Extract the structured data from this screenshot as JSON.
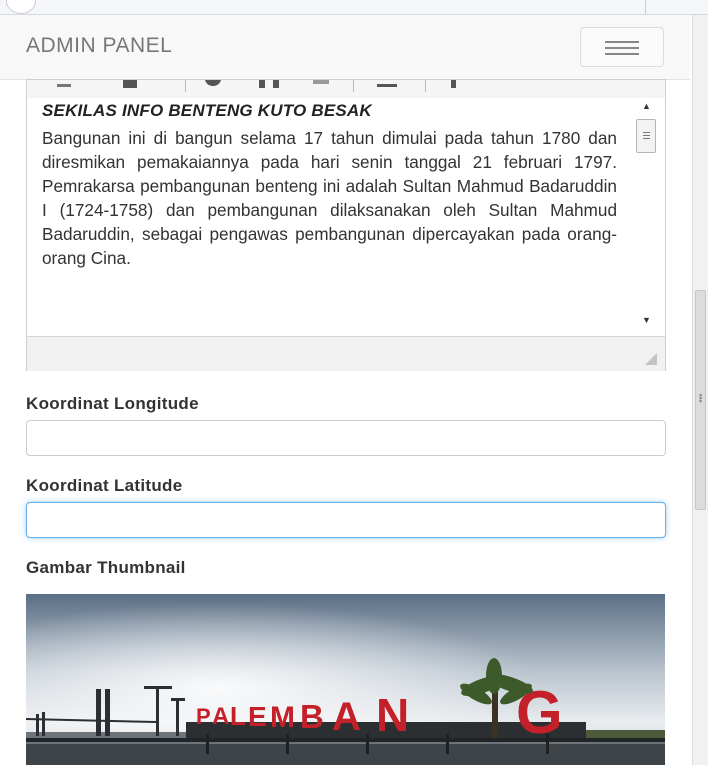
{
  "navbar": {
    "brand": "ADMIN PANEL",
    "menu_icon": "hamburger-menu-icon"
  },
  "editor": {
    "title": "SEKILAS INFO BENTENG KUTO BESAK",
    "body": "Bangunan ini di bangun selama 17 tahun dimulai pada tahun 1780 dan diresmikan pemakaiannya pada hari senin tanggal 21 februari 1797. Pemrakarsa pembangunan benteng ini adalah Sultan Mahmud Badaruddin I (1724-1758) dan pembangunan dilaksanakan oleh Sultan Mahmud Badaruddin, sebagai pengawas pembangunan dipercayakan pada orang-orang Cina."
  },
  "form": {
    "longitude_label": "Koordinat Longitude",
    "longitude_value": "",
    "latitude_label": "Koordinat Latitude",
    "latitude_value": "",
    "thumbnail_label": "Gambar Thumbnail"
  },
  "thumbnail": {
    "sign_text": "PALEMBANG",
    "sign_color": "#c4202a"
  }
}
